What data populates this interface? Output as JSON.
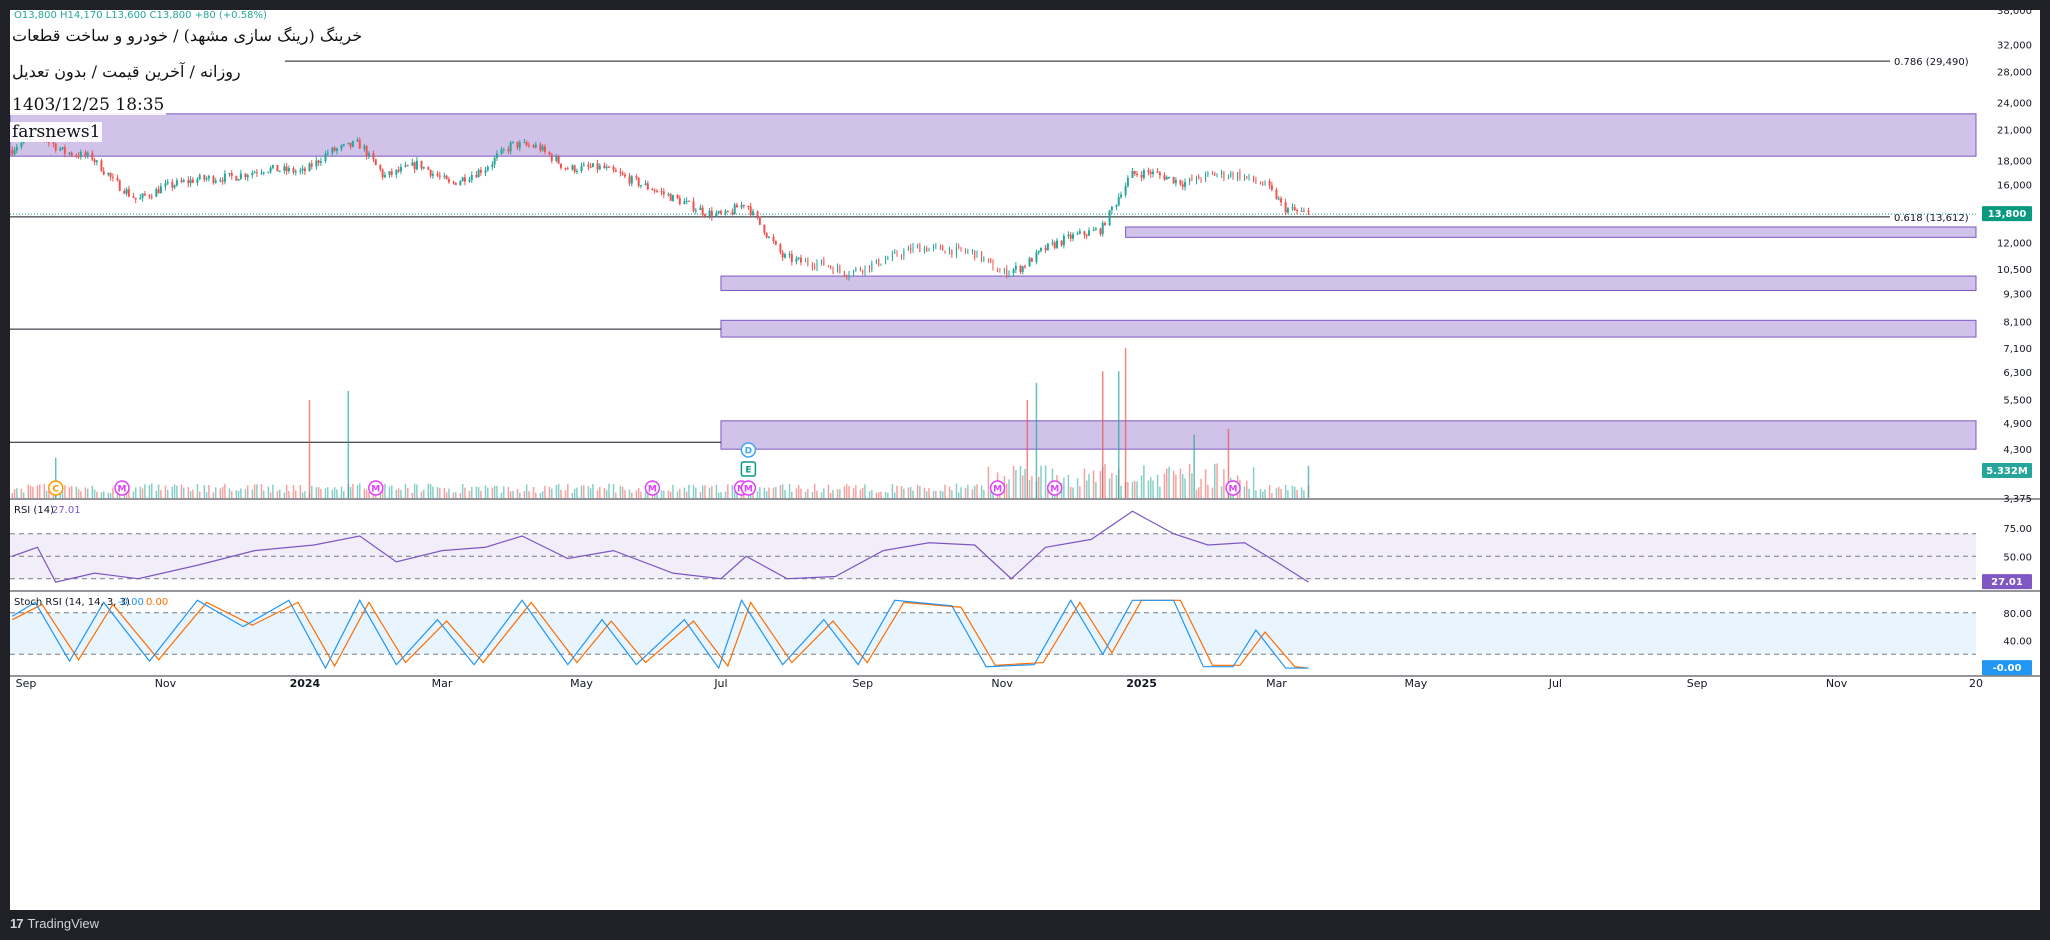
{
  "header": {
    "ohlc_text": "O13,800 H14,170 L13,600 C13,800 +80 (+0.58%)",
    "title": "خرینگ (رینگ سازی مشهد) / خودرو و ساخت قطعات",
    "subtitle": "روزانه / آخرین قیمت / بدون تعدیل",
    "timestamp": "1403/12/25 18:35",
    "author": "farsnews1"
  },
  "footer": {
    "brand": "TradingView",
    "logo_icon": "tradingview-logo-icon"
  },
  "colors": {
    "up": "#26a69a",
    "down": "#ef5350",
    "zone": "#b39ddb",
    "rsi": "#7e57c2",
    "stoch_k": "#2196f3",
    "stoch_d": "#ff6d00",
    "price_badge": "#089981",
    "earnings": "#e040fb"
  },
  "chart_data": [
    {
      "type": "candlestick",
      "name": "price",
      "y_scale": "log",
      "ylim": [
        3375,
        38000
      ],
      "y_ticks": [
        "38,000",
        "32,000",
        "28,000",
        "24,000",
        "21,000",
        "18,000",
        "16,000",
        "14,000",
        "12,000",
        "10,500",
        "9,300",
        "8,100",
        "7,100",
        "6,300",
        "5,500",
        "4,900",
        "4,300",
        "3,375"
      ],
      "x_ticks": [
        "Sep",
        "Nov",
        "2024",
        "Mar",
        "May",
        "Jul",
        "Sep",
        "Nov",
        "2025",
        "Mar",
        "May",
        "Jul",
        "Sep",
        "Nov",
        "20"
      ],
      "x_tick_dates": [
        "2023-09-01",
        "2023-11-01",
        "2024-01-01",
        "2024-03-01",
        "2024-05-01",
        "2024-07-01",
        "2024-09-01",
        "2024-11-01",
        "2025-01-01",
        "2025-03-01",
        "2025-05-01",
        "2025-07-01",
        "2025-09-01",
        "2025-11-01",
        "2026-01-01"
      ],
      "close_path": [
        {
          "x": "2023-08-26",
          "y": 19000
        },
        {
          "x": "2023-09-06",
          "y": 20600
        },
        {
          "x": "2023-09-18",
          "y": 18800
        },
        {
          "x": "2023-09-30",
          "y": 18300
        },
        {
          "x": "2023-10-10",
          "y": 16200
        },
        {
          "x": "2023-10-20",
          "y": 14800
        },
        {
          "x": "2023-11-01",
          "y": 15800
        },
        {
          "x": "2023-11-15",
          "y": 16400
        },
        {
          "x": "2023-12-01",
          "y": 16600
        },
        {
          "x": "2023-12-15",
          "y": 17300
        },
        {
          "x": "2024-01-01",
          "y": 17000
        },
        {
          "x": "2024-01-12",
          "y": 18800
        },
        {
          "x": "2024-01-25",
          "y": 19600
        },
        {
          "x": "2024-02-05",
          "y": 16600
        },
        {
          "x": "2024-02-20",
          "y": 17700
        },
        {
          "x": "2024-03-05",
          "y": 16000
        },
        {
          "x": "2024-03-20",
          "y": 17300
        },
        {
          "x": "2024-04-01",
          "y": 19500
        },
        {
          "x": "2024-04-12",
          "y": 19300
        },
        {
          "x": "2024-04-25",
          "y": 17300
        },
        {
          "x": "2024-05-10",
          "y": 17400
        },
        {
          "x": "2024-05-25",
          "y": 16200
        },
        {
          "x": "2024-06-10",
          "y": 15000
        },
        {
          "x": "2024-06-25",
          "y": 13900
        },
        {
          "x": "2024-07-03",
          "y": 13700
        },
        {
          "x": "2024-07-12",
          "y": 14600
        },
        {
          "x": "2024-07-20",
          "y": 12800
        },
        {
          "x": "2024-07-28",
          "y": 11200
        },
        {
          "x": "2024-08-05",
          "y": 10900
        },
        {
          "x": "2024-08-15",
          "y": 10800
        },
        {
          "x": "2024-08-25",
          "y": 10300
        },
        {
          "x": "2024-09-05",
          "y": 10700
        },
        {
          "x": "2024-09-15",
          "y": 11200
        },
        {
          "x": "2024-09-25",
          "y": 11700
        },
        {
          "x": "2024-10-05",
          "y": 11600
        },
        {
          "x": "2024-10-20",
          "y": 11400
        },
        {
          "x": "2024-11-01",
          "y": 10300
        },
        {
          "x": "2024-11-10",
          "y": 10600
        },
        {
          "x": "2024-11-20",
          "y": 11600
        },
        {
          "x": "2024-12-01",
          "y": 12300
        },
        {
          "x": "2024-12-15",
          "y": 12800
        },
        {
          "x": "2024-12-28",
          "y": 16800
        },
        {
          "x": "2025-01-05",
          "y": 17000
        },
        {
          "x": "2025-01-20",
          "y": 16100
        },
        {
          "x": "2025-02-01",
          "y": 16800
        },
        {
          "x": "2025-02-12",
          "y": 16800
        },
        {
          "x": "2025-02-25",
          "y": 15900
        },
        {
          "x": "2025-03-05",
          "y": 14200
        },
        {
          "x": "2025-03-15",
          "y": 13800
        }
      ],
      "last_price": "13,800",
      "fib_levels": [
        {
          "label": "0.786 (29,490)",
          "value": 29490
        },
        {
          "label": "0.618 (13,612)",
          "value": 13612
        }
      ],
      "zones": [
        {
          "from": "2023-08-25",
          "to": "2026-01-01",
          "low": 18400,
          "high": 22700
        },
        {
          "from": "2024-12-25",
          "to": "2026-01-01",
          "low": 12300,
          "high": 12950
        },
        {
          "from": "2024-07-01",
          "to": "2026-01-01",
          "low": 9450,
          "high": 10150
        },
        {
          "from": "2024-07-01",
          "to": "2026-01-01",
          "low": 7500,
          "high": 8150
        },
        {
          "from": "2024-07-01",
          "to": "2026-01-01",
          "low": 4300,
          "high": 4950
        }
      ],
      "horizontal_lines": [
        {
          "from": "2023-08-25",
          "to": "2024-07-01",
          "value": 7800
        },
        {
          "from": "2023-08-25",
          "to": "2024-07-01",
          "value": 4450
        }
      ],
      "events": [
        {
          "x": "2023-09-14",
          "label": "C"
        },
        {
          "x": "2023-10-13",
          "label": "M"
        },
        {
          "x": "2024-02-01",
          "label": "M"
        },
        {
          "x": "2024-06-01",
          "label": "M"
        },
        {
          "x": "2024-07-10",
          "label": "M"
        },
        {
          "x": "2024-07-13",
          "label": "M"
        },
        {
          "x": "2024-10-30",
          "label": "M"
        },
        {
          "x": "2024-11-24",
          "label": "M"
        },
        {
          "x": "2025-02-10",
          "label": "M"
        },
        {
          "x": "2024-07-13",
          "label": "D"
        },
        {
          "x": "2024-07-13",
          "label": "E"
        }
      ]
    },
    {
      "type": "bar",
      "name": "volume",
      "last_value": "5.332M",
      "spikes": [
        {
          "x": "2023-09-14",
          "rel": 0.35
        },
        {
          "x": "2024-01-03",
          "rel": 0.85
        },
        {
          "x": "2024-01-20",
          "rel": 0.93
        },
        {
          "x": "2024-11-12",
          "rel": 0.85
        },
        {
          "x": "2024-11-16",
          "rel": 1.0
        },
        {
          "x": "2024-12-15",
          "rel": 1.1
        },
        {
          "x": "2024-12-22",
          "rel": 1.1
        },
        {
          "x": "2024-12-25",
          "rel": 1.3
        },
        {
          "x": "2025-01-24",
          "rel": 0.55
        },
        {
          "x": "2025-02-08",
          "rel": 0.6
        },
        {
          "x": "2025-03-15",
          "rel": 0.28
        }
      ]
    },
    {
      "type": "line",
      "name": "RSI (14)",
      "label": "RSI (14)",
      "value_label": "27.01",
      "ylim": [
        20,
        100
      ],
      "levels": [
        70,
        50,
        30
      ],
      "y_ticks": [
        "75.00",
        "50.00",
        "25.00"
      ],
      "values": [
        {
          "x": "2023-08-26",
          "y": 50
        },
        {
          "x": "2023-09-06",
          "y": 58
        },
        {
          "x": "2023-09-14",
          "y": 27
        },
        {
          "x": "2023-10-01",
          "y": 35
        },
        {
          "x": "2023-10-20",
          "y": 30
        },
        {
          "x": "2023-11-15",
          "y": 42
        },
        {
          "x": "2023-12-10",
          "y": 55
        },
        {
          "x": "2024-01-05",
          "y": 60
        },
        {
          "x": "2024-01-25",
          "y": 68
        },
        {
          "x": "2024-02-10",
          "y": 45
        },
        {
          "x": "2024-03-01",
          "y": 55
        },
        {
          "x": "2024-03-20",
          "y": 58
        },
        {
          "x": "2024-04-05",
          "y": 68
        },
        {
          "x": "2024-04-25",
          "y": 48
        },
        {
          "x": "2024-05-15",
          "y": 55
        },
        {
          "x": "2024-06-10",
          "y": 35
        },
        {
          "x": "2024-07-01",
          "y": 30
        },
        {
          "x": "2024-07-12",
          "y": 50
        },
        {
          "x": "2024-07-30",
          "y": 30
        },
        {
          "x": "2024-08-20",
          "y": 32
        },
        {
          "x": "2024-09-10",
          "y": 55
        },
        {
          "x": "2024-09-30",
          "y": 62
        },
        {
          "x": "2024-10-20",
          "y": 60
        },
        {
          "x": "2024-11-05",
          "y": 30
        },
        {
          "x": "2024-11-20",
          "y": 58
        },
        {
          "x": "2024-12-10",
          "y": 65
        },
        {
          "x": "2024-12-28",
          "y": 90
        },
        {
          "x": "2025-01-15",
          "y": 70
        },
        {
          "x": "2025-01-30",
          "y": 60
        },
        {
          "x": "2025-02-15",
          "y": 62
        },
        {
          "x": "2025-03-01",
          "y": 45
        },
        {
          "x": "2025-03-15",
          "y": 27
        }
      ]
    },
    {
      "type": "line",
      "name": "Stoch RSI (14, 14, 3, 3)",
      "label": "Stoch RSI (14, 14, 3, 3)",
      "k_label": "-0.00",
      "d_label": "0.00",
      "value_label": "-0.00",
      "ylim": [
        -10,
        110
      ],
      "levels": [
        80,
        20
      ],
      "y_ticks": [
        "80.00",
        "40.00"
      ],
      "k_values": [
        {
          "x": "2023-08-26",
          "y": 75
        },
        {
          "x": "2023-09-05",
          "y": 95
        },
        {
          "x": "2023-09-20",
          "y": 10
        },
        {
          "x": "2023-10-05",
          "y": 95
        },
        {
          "x": "2023-10-25",
          "y": 10
        },
        {
          "x": "2023-11-15",
          "y": 98
        },
        {
          "x": "2023-12-05",
          "y": 60
        },
        {
          "x": "2023-12-25",
          "y": 98
        },
        {
          "x": "2024-01-10",
          "y": 0
        },
        {
          "x": "2024-01-25",
          "y": 98
        },
        {
          "x": "2024-02-10",
          "y": 5
        },
        {
          "x": "2024-02-28",
          "y": 70
        },
        {
          "x": "2024-03-15",
          "y": 5
        },
        {
          "x": "2024-04-05",
          "y": 98
        },
        {
          "x": "2024-04-25",
          "y": 5
        },
        {
          "x": "2024-05-10",
          "y": 70
        },
        {
          "x": "2024-05-25",
          "y": 5
        },
        {
          "x": "2024-06-15",
          "y": 70
        },
        {
          "x": "2024-06-30",
          "y": 0
        },
        {
          "x": "2024-07-10",
          "y": 98
        },
        {
          "x": "2024-07-28",
          "y": 5
        },
        {
          "x": "2024-08-15",
          "y": 70
        },
        {
          "x": "2024-08-30",
          "y": 5
        },
        {
          "x": "2024-09-15",
          "y": 98
        },
        {
          "x": "2024-10-10",
          "y": 90
        },
        {
          "x": "2024-10-25",
          "y": 2
        },
        {
          "x": "2024-11-15",
          "y": 5
        },
        {
          "x": "2024-12-01",
          "y": 98
        },
        {
          "x": "2024-12-15",
          "y": 20
        },
        {
          "x": "2024-12-28",
          "y": 98
        },
        {
          "x": "2025-01-15",
          "y": 98
        },
        {
          "x": "2025-01-28",
          "y": 2
        },
        {
          "x": "2025-02-10",
          "y": 2
        },
        {
          "x": "2025-02-20",
          "y": 55
        },
        {
          "x": "2025-03-05",
          "y": 0
        },
        {
          "x": "2025-03-15",
          "y": 0
        }
      ],
      "d_values": [
        {
          "x": "2023-08-26",
          "y": 70
        },
        {
          "x": "2023-09-08",
          "y": 92
        },
        {
          "x": "2023-09-24",
          "y": 12
        },
        {
          "x": "2023-10-09",
          "y": 92
        },
        {
          "x": "2023-10-29",
          "y": 12
        },
        {
          "x": "2023-11-19",
          "y": 95
        },
        {
          "x": "2023-12-09",
          "y": 62
        },
        {
          "x": "2023-12-29",
          "y": 95
        },
        {
          "x": "2024-01-14",
          "y": 3
        },
        {
          "x": "2024-01-29",
          "y": 95
        },
        {
          "x": "2024-02-14",
          "y": 8
        },
        {
          "x": "2024-03-03",
          "y": 68
        },
        {
          "x": "2024-03-19",
          "y": 8
        },
        {
          "x": "2024-04-09",
          "y": 95
        },
        {
          "x": "2024-04-29",
          "y": 8
        },
        {
          "x": "2024-05-14",
          "y": 68
        },
        {
          "x": "2024-05-29",
          "y": 8
        },
        {
          "x": "2024-06-19",
          "y": 68
        },
        {
          "x": "2024-07-04",
          "y": 3
        },
        {
          "x": "2024-07-14",
          "y": 95
        },
        {
          "x": "2024-08-01",
          "y": 8
        },
        {
          "x": "2024-08-19",
          "y": 68
        },
        {
          "x": "2024-09-03",
          "y": 8
        },
        {
          "x": "2024-09-19",
          "y": 95
        },
        {
          "x": "2024-10-14",
          "y": 88
        },
        {
          "x": "2024-10-29",
          "y": 4
        },
        {
          "x": "2024-11-19",
          "y": 8
        },
        {
          "x": "2024-12-05",
          "y": 95
        },
        {
          "x": "2024-12-19",
          "y": 22
        },
        {
          "x": "2025-01-01",
          "y": 98
        },
        {
          "x": "2025-01-18",
          "y": 98
        },
        {
          "x": "2025-02-01",
          "y": 4
        },
        {
          "x": "2025-02-13",
          "y": 4
        },
        {
          "x": "2025-02-24",
          "y": 52
        },
        {
          "x": "2025-03-09",
          "y": 2
        },
        {
          "x": "2025-03-15",
          "y": 0
        }
      ]
    }
  ]
}
